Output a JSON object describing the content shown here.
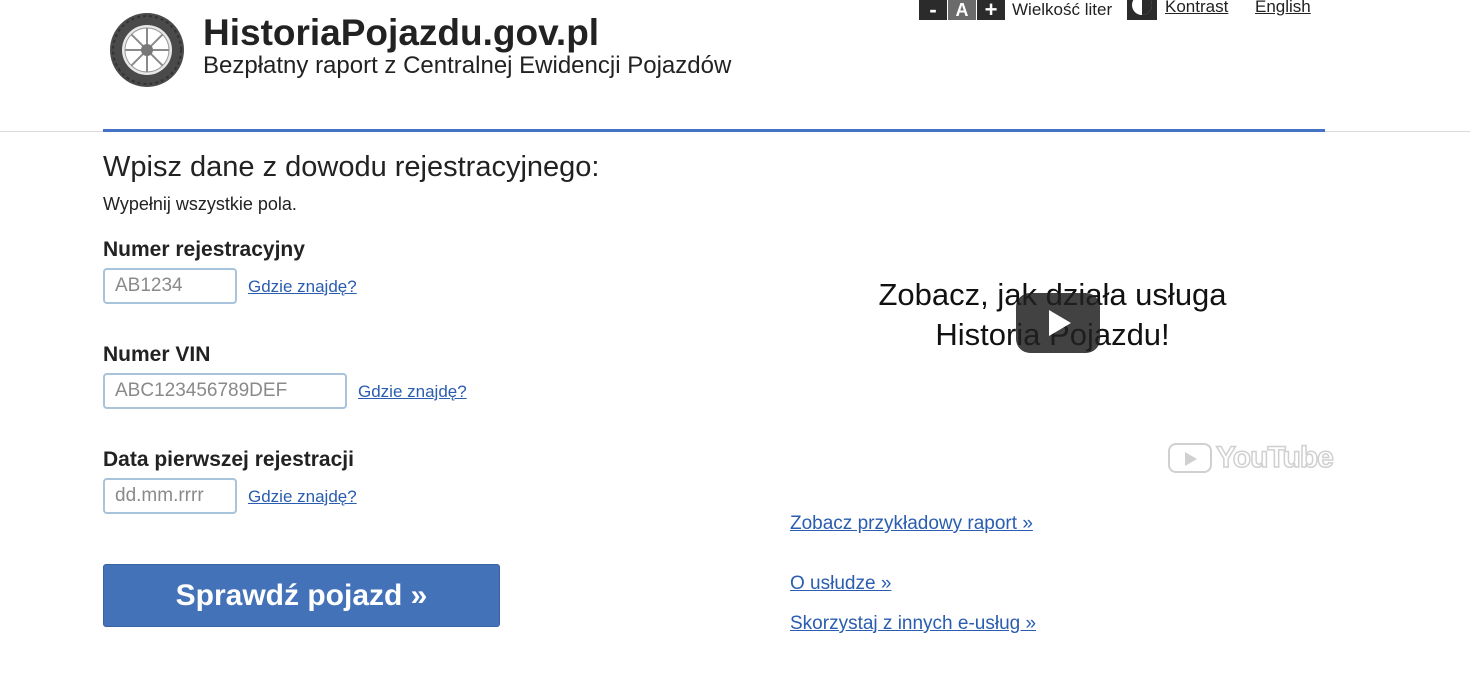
{
  "header": {
    "title": "HistoriaPojazdu.gov.pl",
    "subtitle": "Bezpłatny raport z Centralnej Ewidencji Pojazdów"
  },
  "accessibility": {
    "decrease_label": "-",
    "default_label": "A",
    "increase_label": "+",
    "font_size_label": "Wielkość liter",
    "contrast_label": "Kontrast",
    "language_label": "English"
  },
  "form": {
    "heading": "Wpisz dane z dowodu rejestracyjnego:",
    "hint": "Wypełnij wszystkie pola.",
    "registration": {
      "label": "Numer rejestracyjny",
      "placeholder": "AB1234",
      "value": "",
      "help": "Gdzie znajdę?"
    },
    "vin": {
      "label": "Numer VIN",
      "placeholder": "ABC123456789DEF",
      "value": "",
      "help": "Gdzie znajdę?"
    },
    "first_registration": {
      "label": "Data pierwszej rejestracji",
      "placeholder": "dd.mm.rrrr",
      "value": "",
      "help": "Gdzie znajdę?"
    },
    "submit_label": "Sprawdź pojazd »"
  },
  "video": {
    "title_line1": "Zobacz, jak działa usługa",
    "title_line2": "Historia Pojazdu!",
    "provider": "YouTube"
  },
  "links": {
    "sample_report": "Zobacz przykładowy raport »",
    "about": "O usłudze »",
    "other_services": "Skorzystaj z innych e-usług »"
  },
  "colors": {
    "accent": "#4472c4",
    "button": "#4472b8",
    "link": "#2a5db0"
  }
}
